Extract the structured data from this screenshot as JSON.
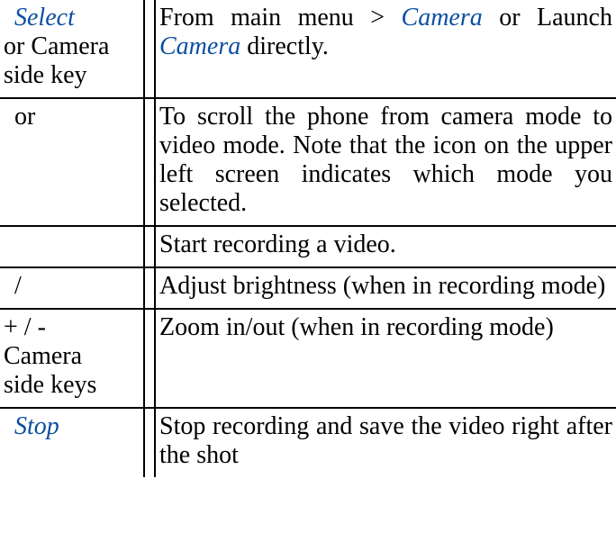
{
  "rows": [
    {
      "key": {
        "soft_label": "Select",
        "plain_lines": [
          "or Camera",
          "side key"
        ]
      },
      "desc": {
        "prefix": "From main menu > ",
        "soft1": "Camera",
        "mid": " or Launch ",
        "soft2": "Camera",
        "suffix": " directly."
      }
    },
    {
      "key": {
        "plain_center": "or"
      },
      "desc": {
        "text": "To scroll the phone from camera mode to video mode. Note that the icon on the upper left screen indicates which mode you selected."
      }
    },
    {
      "key": {
        "blank": ""
      },
      "desc": {
        "text": "Start recording a video."
      }
    },
    {
      "key": {
        "plain_center": "/"
      },
      "desc": {
        "text": "Adjust brightness (when in recording mode)"
      }
    },
    {
      "key": {
        "plain_lines": [
          "+ / -",
          "Camera",
          "side keys"
        ]
      },
      "desc": {
        "text": "Zoom in/out (when in recording mode)"
      }
    },
    {
      "key": {
        "soft_label": "Stop"
      },
      "desc": {
        "text": "Stop recording and save the video right after the shot"
      }
    }
  ]
}
